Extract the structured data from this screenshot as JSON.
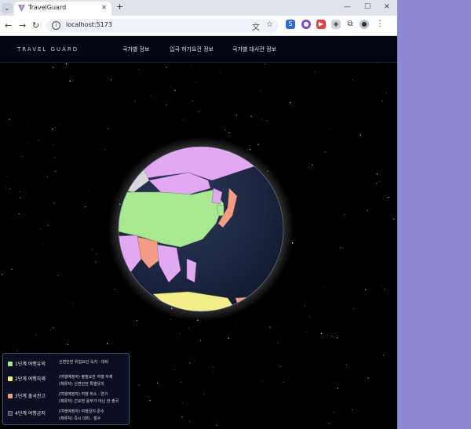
{
  "browser": {
    "tab_title": "TravelGuard",
    "url": "localhost:5173"
  },
  "app": {
    "logo": "TRAVEL GUARD",
    "nav": [
      "국가별 정보",
      "입국 허가요건 정보",
      "국가별 대사관 정보"
    ]
  },
  "legend": [
    {
      "name": "1단계 여행유의",
      "color": "#a8e890",
      "desc": "신변안전 위험요인 숙지 · 대비"
    },
    {
      "name": "2단계 여행자제",
      "color": "#f2ef8a",
      "desc": "(여행예정자) 불필요한 여행 자제\n(체류자) 신변안전 특별유의"
    },
    {
      "name": "3단계 출국권고",
      "color": "#f29b86",
      "desc": "(여행예정자) 여행 취소 · 연기\n(체류자) 긴요한 용무가 아닌 한 출국"
    },
    {
      "name": "4단계 여행금지",
      "color": "#3a3f4f",
      "desc": "(여행예정자) 여행금지 준수\n(체류자) 즉시 대피 · 철수"
    }
  ],
  "colors": {
    "level1": "#a8e890",
    "level2": "#f2ef8a",
    "level3": "#f29b86",
    "level4": "#3a3f4f",
    "no_data": "#e3a8f2",
    "ocean": "#1d2640"
  }
}
